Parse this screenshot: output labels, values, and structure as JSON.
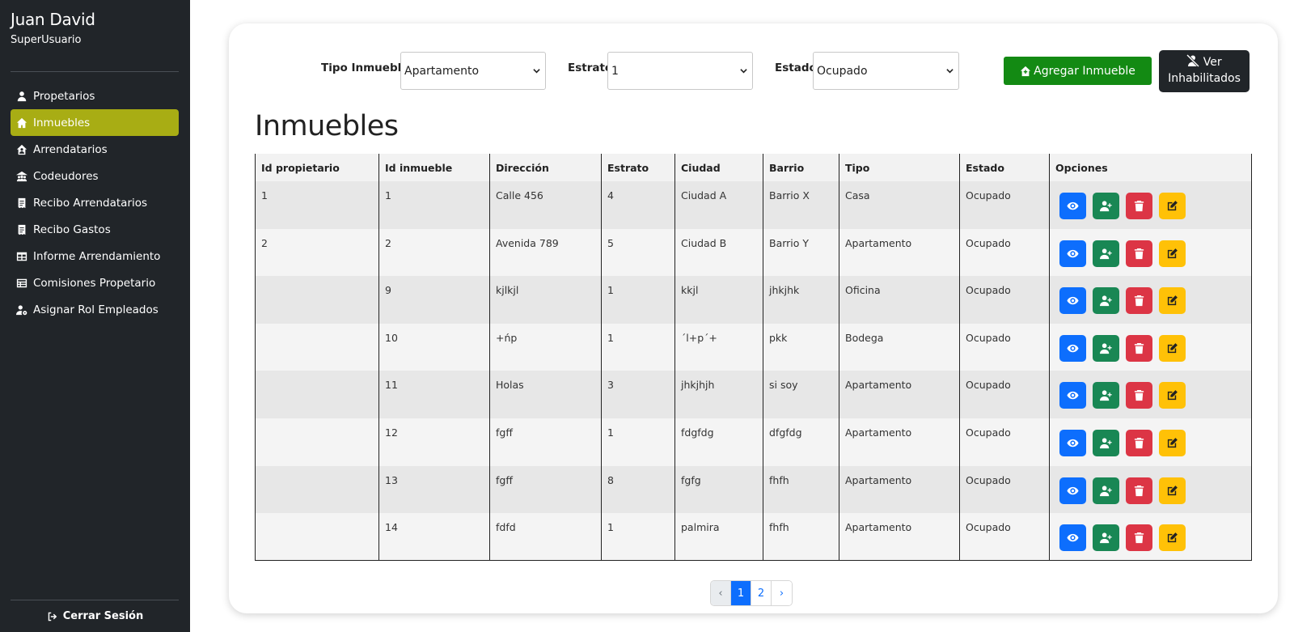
{
  "user": {
    "name": "Juan David",
    "role": "SuperUsuario"
  },
  "nav": [
    {
      "label": "Propetarios",
      "icon": "user-icon",
      "active": false
    },
    {
      "label": "Inmuebles",
      "icon": "house-icon",
      "active": true
    },
    {
      "label": "Arrendatarios",
      "icon": "house-user-icon",
      "active": false
    },
    {
      "label": "Codeudores",
      "icon": "people-roof-icon",
      "active": false
    },
    {
      "label": "Recibo Arrendatarios",
      "icon": "receipt-icon",
      "active": false
    },
    {
      "label": "Recibo Gastos",
      "icon": "receipt-icon",
      "active": false
    },
    {
      "label": "Informe Arrendamiento",
      "icon": "table-icon",
      "active": false
    },
    {
      "label": "Comisiones Propetario",
      "icon": "list-table-icon",
      "active": false
    },
    {
      "label": "Asignar Rol Empleados",
      "icon": "user-gear-icon",
      "active": false
    }
  ],
  "logout_label": "Cerrar Sesión",
  "filters": {
    "tipo": {
      "label": "Tipo Inmueble",
      "value": "Apartamento"
    },
    "estrato": {
      "label": "Estrato",
      "value": "1"
    },
    "estado": {
      "label": "Estado",
      "value": "Ocupado"
    }
  },
  "buttons": {
    "add": "Agregar Inmueble",
    "inhab_line1": "Ver",
    "inhab_line2": "Inhabilitados"
  },
  "title": "Inmuebles",
  "table": {
    "headers": [
      "Id propietario",
      "Id inmueble",
      "Dirección",
      "Estrato",
      "Ciudad",
      "Barrio",
      "Tipo",
      "Estado",
      "Opciones"
    ],
    "rows": [
      [
        "1",
        "1",
        "Calle 456",
        "4",
        "Ciudad A",
        "Barrio X",
        "Casa",
        "Ocupado"
      ],
      [
        "2",
        "2",
        "Avenida 789",
        "5",
        "Ciudad B",
        "Barrio Y",
        "Apartamento",
        "Ocupado"
      ],
      [
        "",
        "9",
        "kjlkjl",
        "1",
        "kkjl",
        "jhkjhk",
        "Oficina",
        "Ocupado"
      ],
      [
        "",
        "10",
        "+ńp",
        "1",
        "´l+p´+",
        "pkk",
        "Bodega",
        "Ocupado"
      ],
      [
        "",
        "11",
        "Holas",
        "3",
        "jhkjhjh",
        "si soy",
        "Apartamento",
        "Ocupado"
      ],
      [
        "",
        "12",
        "fgff",
        "1",
        "fdgfdg",
        "dfgfdg",
        "Apartamento",
        "Ocupado"
      ],
      [
        "",
        "13",
        "fgff",
        "8",
        "fgfg",
        "fhfh",
        "Apartamento",
        "Ocupado"
      ],
      [
        "",
        "14",
        "fdfd",
        "1",
        "palmira",
        "fhfh",
        "Apartamento",
        "Ocupado"
      ]
    ]
  },
  "pagination": {
    "prev": "‹",
    "pages": [
      "1",
      "2"
    ],
    "current": "1",
    "next": "›"
  },
  "colors": {
    "sidebar": "#212529",
    "active_nav": "#a8ad14",
    "add_button": "#138a13",
    "view": "#0d6efd",
    "assign": "#198754",
    "delete": "#dc3545",
    "edit": "#ffc107"
  }
}
